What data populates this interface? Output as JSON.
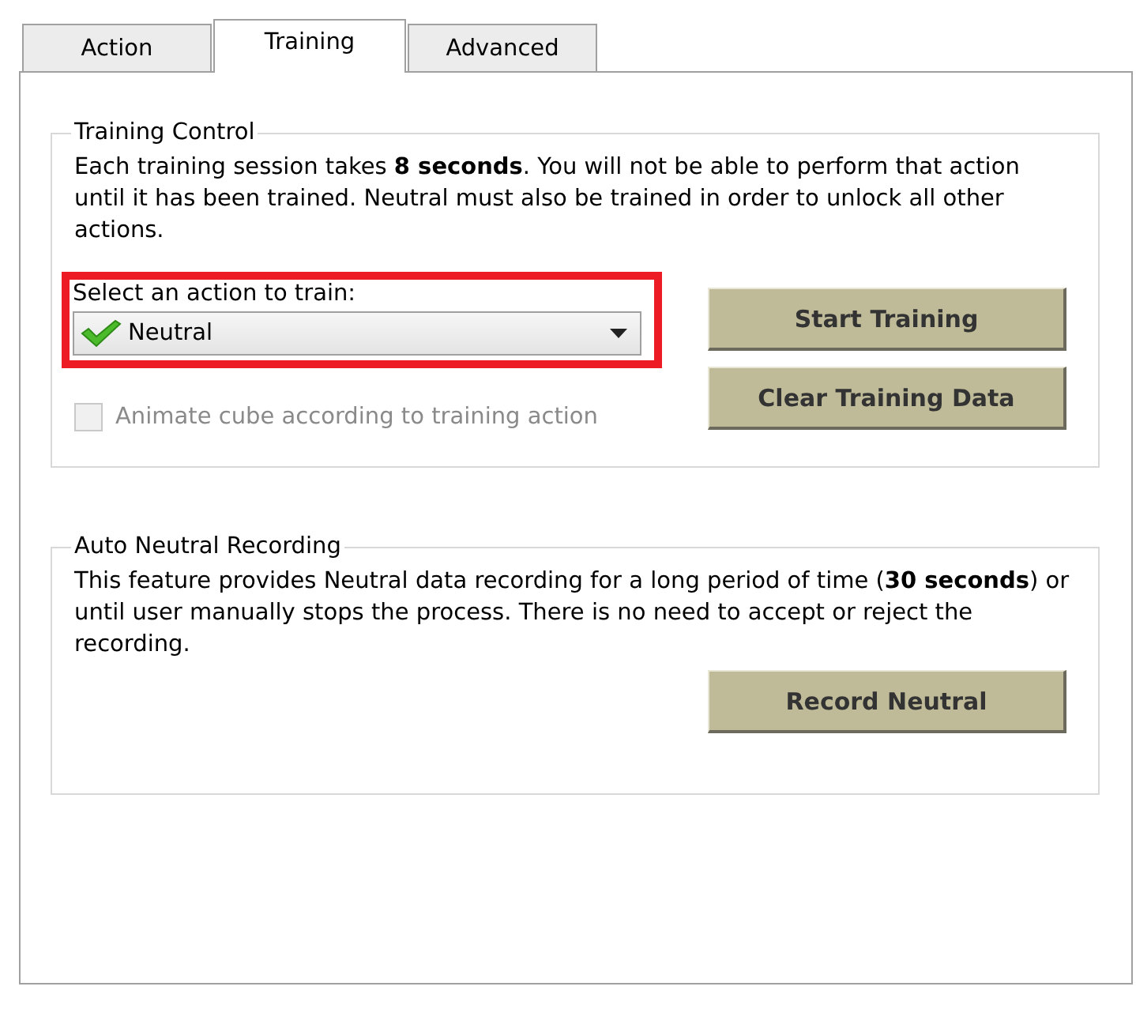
{
  "tabs": [
    {
      "label": "Action",
      "selected": false
    },
    {
      "label": "Training",
      "selected": true
    },
    {
      "label": "Advanced",
      "selected": false
    }
  ],
  "training_control": {
    "title": "Training Control",
    "description": "Each training session takes **8 seconds**. You will not be able to perform that action until it has been trained. Neutral must also be trained in order to unlock all other actions.",
    "highlighted": true,
    "select_label": "Select an action to train:",
    "action_dropdown": {
      "value": "Neutral",
      "trained": true
    },
    "animate_checkbox": {
      "label": "Animate cube according to training action",
      "checked": false,
      "disabled": true
    },
    "buttons": [
      "Start Training",
      "Clear Training Data"
    ]
  },
  "auto_neutral_recording": {
    "title": "Auto Neutral Recording",
    "description": "This feature provides Neutral data recording for a long period of time (**30 seconds**) or until user manually stops the process. There is no need to accept or reject the recording.",
    "buttons": [
      "Record Neutral"
    ]
  }
}
